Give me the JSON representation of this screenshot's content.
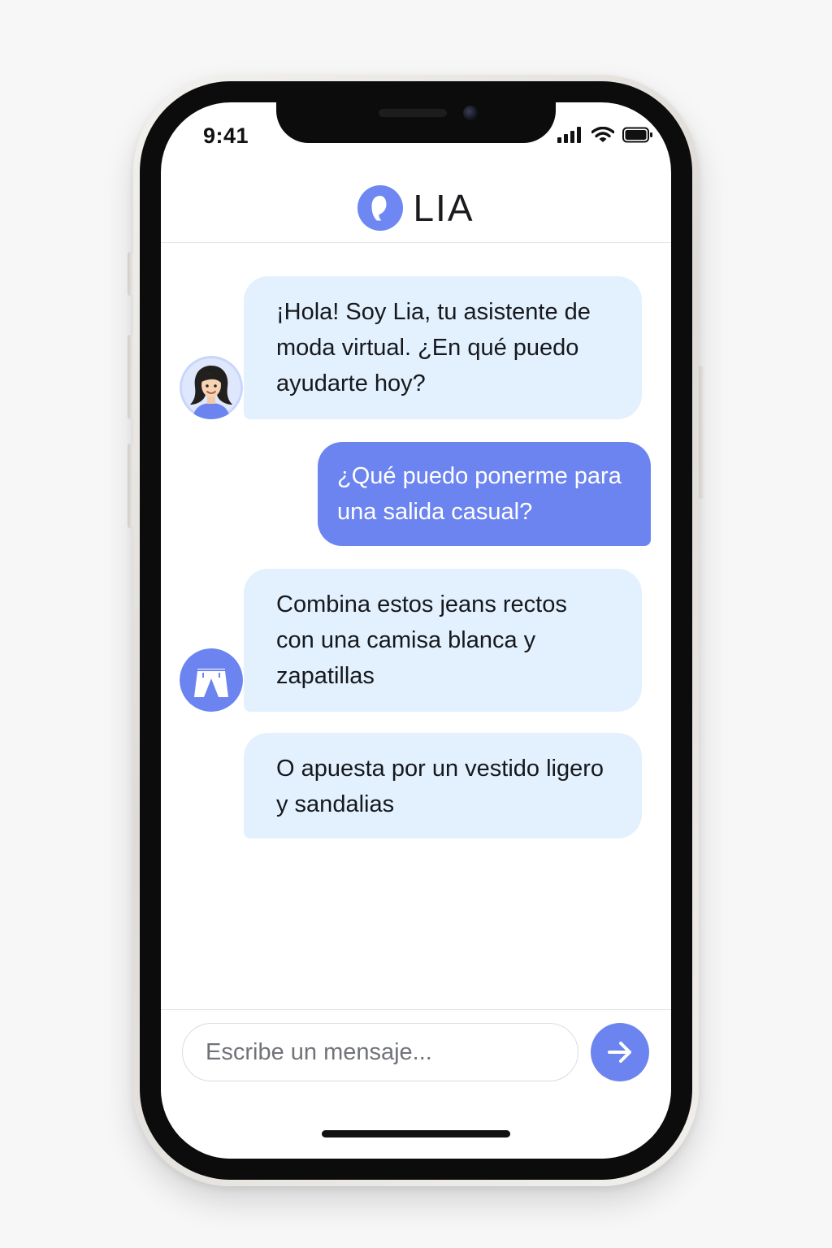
{
  "status_bar": {
    "time": "9:41",
    "icons": [
      "signal-icon",
      "wifi-icon",
      "battery-icon"
    ]
  },
  "header": {
    "title": "LIA",
    "logo_icon": "lia-logo-icon"
  },
  "messages": [
    {
      "sender": "bot",
      "avatar": "assistant-avatar",
      "text": "¡Hola! Soy Lia, tu asistente de moda virtual. ¿En qué puedo ayudarte hoy?"
    },
    {
      "sender": "user",
      "text": "¿Qué puedo ponerme para una salida casual?"
    },
    {
      "sender": "bot",
      "avatar": "jeans-avatar",
      "text": "Combina estos jeans rectos con una camisa blanca y zapatillas"
    },
    {
      "sender": "bot",
      "text": "O apuesta por un vestido ligero y sandalias"
    }
  ],
  "composer": {
    "placeholder": "Escribe un mensaje...",
    "value": "",
    "send_icon": "arrow-right-icon"
  },
  "colors": {
    "accent": "#6c84f0",
    "bot_bubble": "#e2f1fd",
    "user_bubble": "#6c84f0",
    "background": "#ffffff"
  }
}
